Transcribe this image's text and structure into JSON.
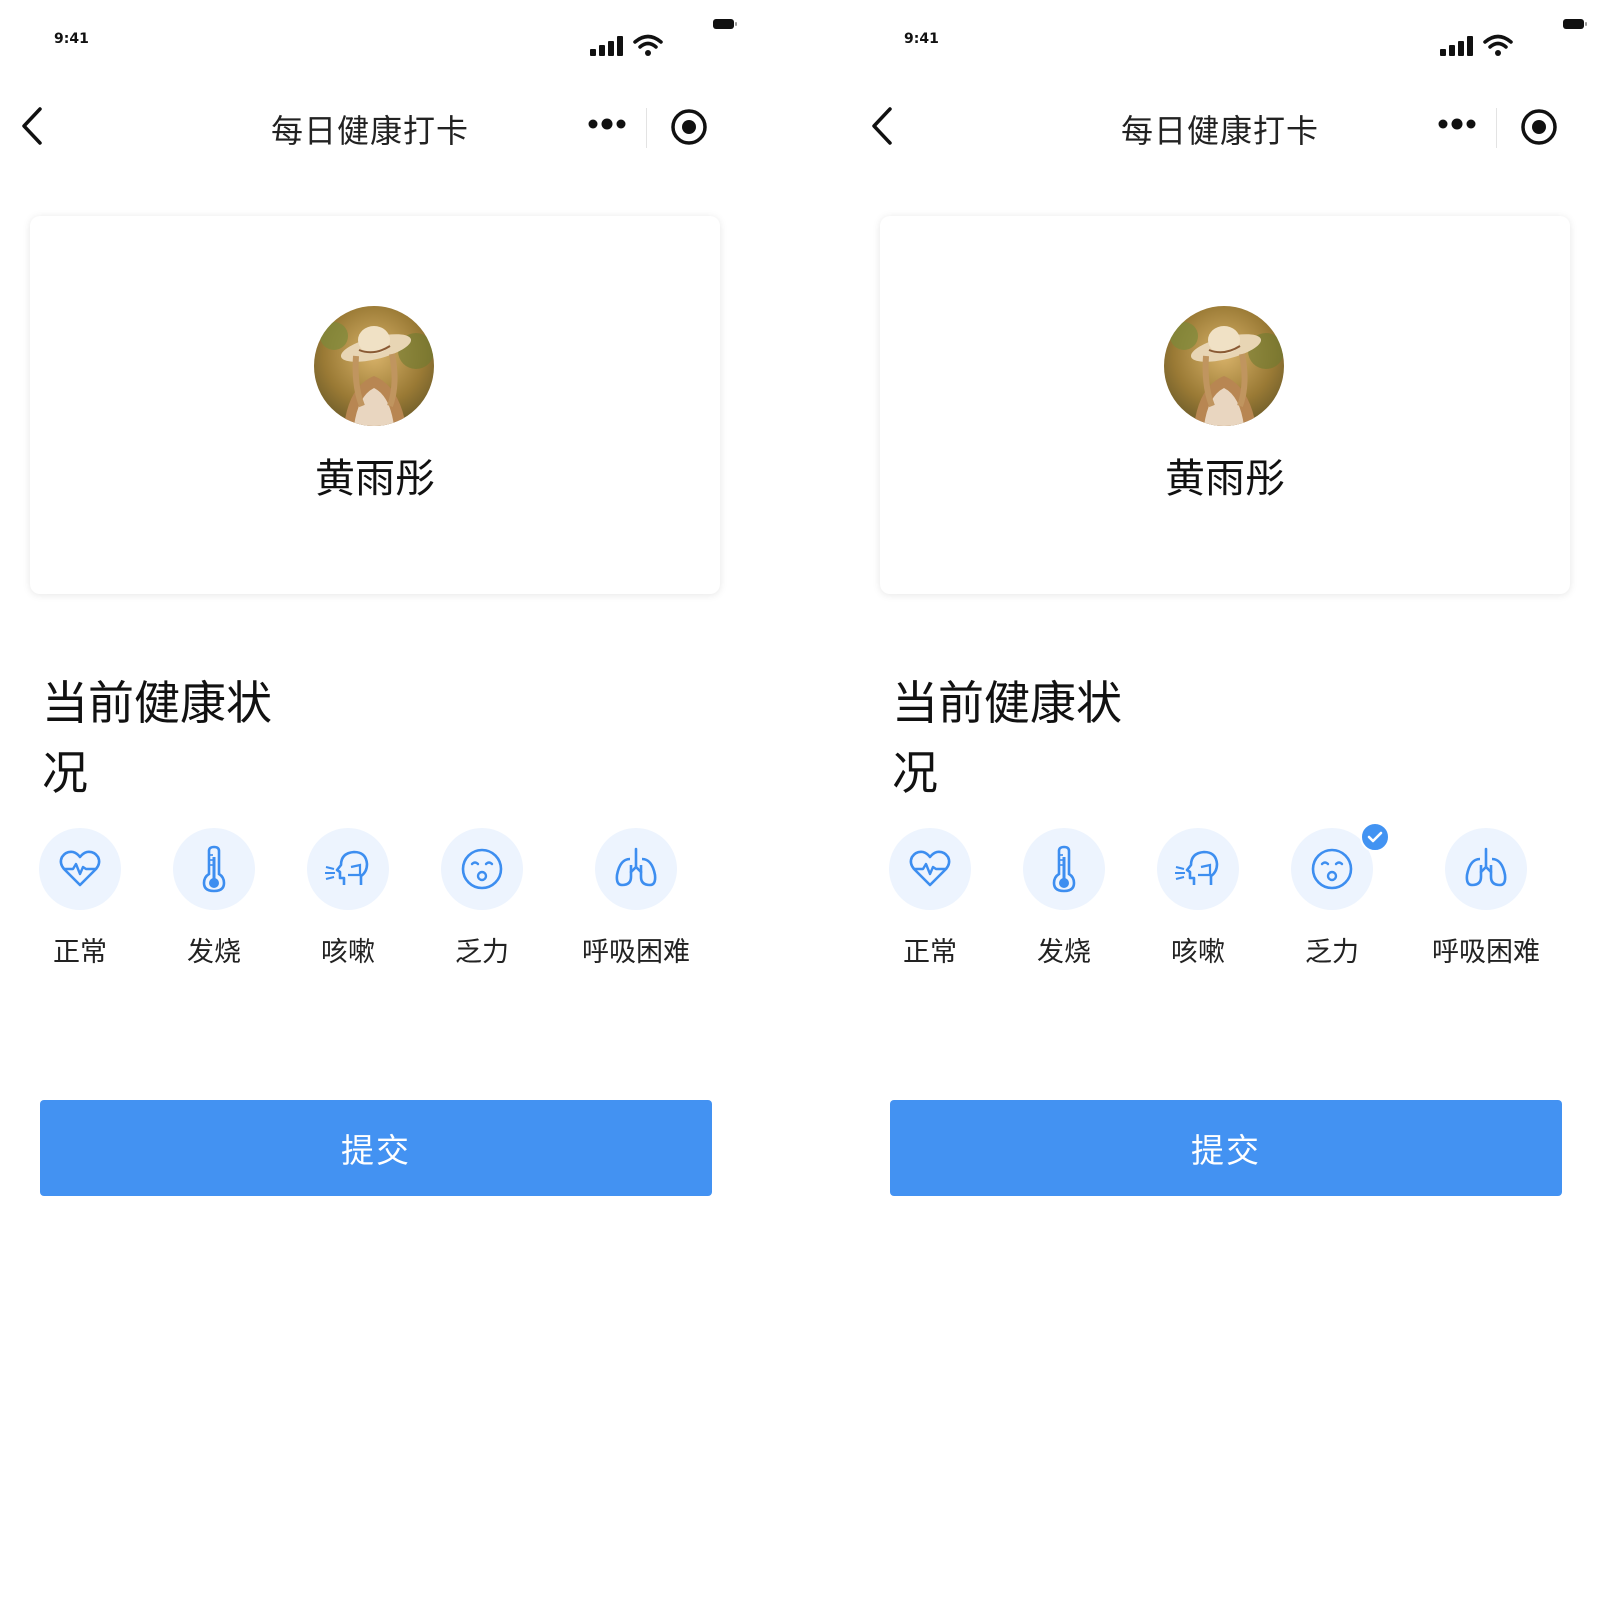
{
  "status_bar": {
    "time": "9:41"
  },
  "nav": {
    "title": "每日健康打卡"
  },
  "profile": {
    "name": "黄雨彤"
  },
  "section": {
    "title": "当前健康状况"
  },
  "options": [
    {
      "label": "正常",
      "icon": "heart-pulse-icon"
    },
    {
      "label": "发烧",
      "icon": "thermometer-icon"
    },
    {
      "label": "咳嗽",
      "icon": "cough-icon"
    },
    {
      "label": "乏力",
      "icon": "tired-face-icon"
    },
    {
      "label": "呼吸困难",
      "icon": "lungs-icon"
    }
  ],
  "screens": [
    {
      "selected_option": null
    },
    {
      "selected_option": "乏力"
    }
  ],
  "submit": {
    "label": "提交"
  },
  "colors": {
    "accent": "#4392f2",
    "icon_bg": "#edf4fe",
    "icon_stroke": "#3d8ef0"
  }
}
